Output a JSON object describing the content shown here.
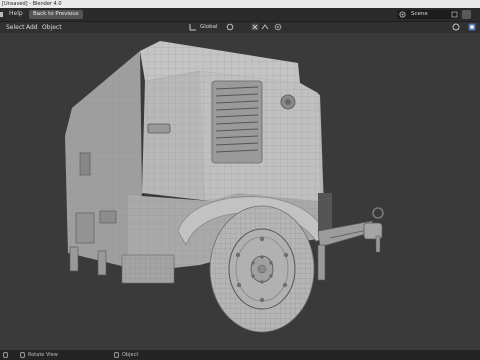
{
  "window": {
    "title": "[Unsaved] - Blender 4.0"
  },
  "topbar": {
    "help_label": "Help",
    "back_label": "Back to Previous",
    "scene_label": "Scene"
  },
  "header": {
    "menus": [
      "Select",
      "Add",
      "Object"
    ],
    "transform_orientation": "Global"
  },
  "statusbar": {
    "items": [
      "Rotate View",
      "Object"
    ]
  },
  "icons": [
    "menu-icon",
    "scene-icon",
    "view-layer-icon",
    "transform-orientation-icon",
    "pivot-icon",
    "snap-icon",
    "proportional-edit-icon",
    "overlay-icon",
    "shading-icon",
    "mouse-left-icon",
    "mouse-middle-icon",
    "mouse-right-icon"
  ],
  "colors": {
    "viewport_bg": "#3a3a3a",
    "model_clay": "#b9b9b9",
    "header_bg": "#303030"
  }
}
